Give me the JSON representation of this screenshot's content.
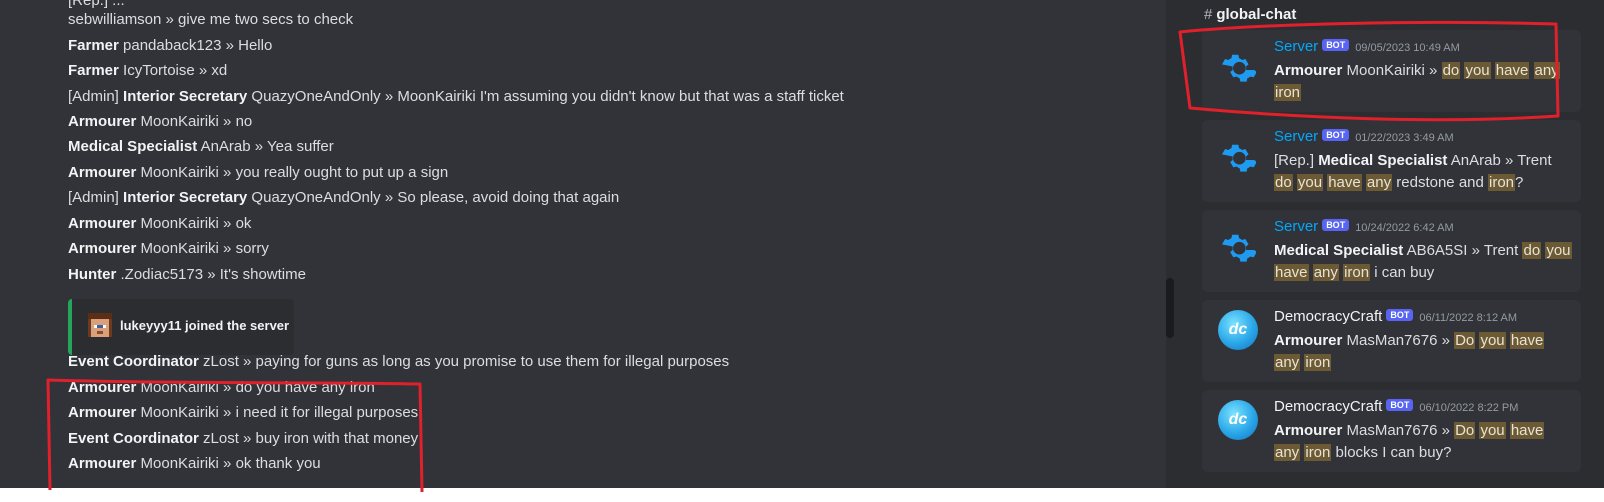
{
  "chat": {
    "partial_top": "[Rep.] ...",
    "lines": [
      {
        "rank_prefix": "",
        "rank": "",
        "name": "sebwilliamson",
        "msg": " » give me two secs to check"
      },
      {
        "rank_prefix": "",
        "rank": "Farmer",
        "name": " pandaback123",
        "msg": " » Hello"
      },
      {
        "rank_prefix": "",
        "rank": "Farmer",
        "name": " IcyTortoise",
        "msg": " » xd"
      },
      {
        "rank_prefix": "[Admin] ",
        "rank": "Interior Secretary",
        "name": " QuazyOneAndOnly",
        "msg": " » MoonKairiki I'm assuming you didn't know but that was a staff ticket"
      },
      {
        "rank_prefix": "",
        "rank": "Armourer",
        "name": " MoonKairiki",
        "msg": " » no"
      },
      {
        "rank_prefix": "",
        "rank": "Medical Specialist",
        "name": " AnArab",
        "msg": " » Yea suffer"
      },
      {
        "rank_prefix": "",
        "rank": "Armourer",
        "name": " MoonKairiki",
        "msg": " » you really ought to put up a sign"
      },
      {
        "rank_prefix": "[Admin] ",
        "rank": "Interior Secretary",
        "name": " QuazyOneAndOnly",
        "msg": " » So please, avoid doing that again"
      },
      {
        "rank_prefix": "",
        "rank": "Armourer",
        "name": " MoonKairiki",
        "msg": " » ok"
      },
      {
        "rank_prefix": "",
        "rank": "Armourer",
        "name": " MoonKairiki",
        "msg": " » sorry"
      },
      {
        "rank_prefix": "",
        "rank": "Hunter",
        "name": " .Zodiac5173",
        "msg": " » It's showtime"
      },
      {
        "rank_prefix": "",
        "rank": "Event Coordinator",
        "name": " zLost",
        "msg": " » paying for guns as long as you promise to use them for illegal purposes"
      },
      {
        "rank_prefix": "",
        "rank": "Armourer",
        "name": " MoonKairiki",
        "msg": " » do you have any iron"
      },
      {
        "rank_prefix": "",
        "rank": "Armourer",
        "name": " MoonKairiki",
        "msg": " » i need it for illegal purposes"
      },
      {
        "rank_prefix": "",
        "rank": "Event Coordinator",
        "name": " zLost",
        "msg": " » buy iron with that money"
      },
      {
        "rank_prefix": "",
        "rank": "Armourer",
        "name": " MoonKairiki",
        "msg": " » ok thank you"
      }
    ],
    "join_embed": {
      "text": "lukeyyy11 joined the server",
      "accent": "#23a55a"
    }
  },
  "search": {
    "channel_hash": "#",
    "channel": "global-chat",
    "bot_tag": "BOT",
    "results": [
      {
        "author": "Server",
        "time": "09/05/2023 10:49 AM",
        "icon": "gear-icon",
        "parts": [
          {
            "t": "Armourer",
            "b": true
          },
          {
            "t": " MoonKairiki » "
          },
          {
            "t": "do",
            "h": true
          },
          {
            "t": " "
          },
          {
            "t": "you",
            "h": true
          },
          {
            "t": " "
          },
          {
            "t": "have",
            "h": true
          },
          {
            "t": " "
          },
          {
            "t": "any",
            "h": true
          },
          {
            "t": " "
          },
          {
            "t": "iron",
            "h": true
          }
        ]
      },
      {
        "author": "Server",
        "time": "01/22/2023 3:49 AM",
        "icon": "gear-icon",
        "parts": [
          {
            "t": "[Rep.]   "
          },
          {
            "t": "Medical Specialist",
            "b": true
          },
          {
            "t": " AnArab »  Trent "
          },
          {
            "t": "do",
            "h": true
          },
          {
            "t": " "
          },
          {
            "t": "you",
            "h": true
          },
          {
            "t": " "
          },
          {
            "t": "have",
            "h": true
          },
          {
            "t": " "
          },
          {
            "t": "any",
            "h": true
          },
          {
            "t": " redstone and "
          },
          {
            "t": "iron",
            "h": true
          },
          {
            "t": "?"
          }
        ]
      },
      {
        "author": "Server",
        "time": "10/24/2022 6:42 AM",
        "icon": "gear-icon",
        "parts": [
          {
            "t": "Medical Specialist",
            "b": true
          },
          {
            "t": " AB6A5SI » Trent "
          },
          {
            "t": "do",
            "h": true
          },
          {
            "t": " "
          },
          {
            "t": "you",
            "h": true
          },
          {
            "t": " "
          },
          {
            "t": "have",
            "h": true
          },
          {
            "t": " "
          },
          {
            "t": "any",
            "h": true
          },
          {
            "t": " "
          },
          {
            "t": "iron",
            "h": true
          },
          {
            "t": " i can buy"
          }
        ]
      },
      {
        "author": "DemocracyCraft",
        "time": "06/11/2022 8:12 AM",
        "icon": "dc-logo",
        "parts": [
          {
            "t": "Armourer",
            "b": true
          },
          {
            "t": " MasMan7676 »  "
          },
          {
            "t": "Do",
            "h": true
          },
          {
            "t": " "
          },
          {
            "t": "you",
            "h": true
          },
          {
            "t": " "
          },
          {
            "t": "have",
            "h": true
          },
          {
            "t": " "
          },
          {
            "t": "any",
            "h": true
          },
          {
            "t": " "
          },
          {
            "t": "iron",
            "h": true
          }
        ]
      },
      {
        "author": "DemocracyCraft",
        "time": "06/10/2022 8:22 PM",
        "icon": "dc-logo",
        "parts": [
          {
            "t": "Armourer",
            "b": true
          },
          {
            "t": " MasMan7676 »  "
          },
          {
            "t": "Do",
            "h": true
          },
          {
            "t": " "
          },
          {
            "t": "you",
            "h": true
          },
          {
            "t": " "
          },
          {
            "t": "have",
            "h": true
          },
          {
            "t": " "
          },
          {
            "t": "any",
            "h": true
          },
          {
            "t": " "
          },
          {
            "t": "iron",
            "h": true
          },
          {
            "t": " blocks I can buy?"
          }
        ]
      }
    ]
  },
  "colors": {
    "annotation_red": "#e0202a",
    "highlight": "#6b5a33",
    "server_name": "#00a8fc",
    "bot_tag": "#5865f2"
  }
}
